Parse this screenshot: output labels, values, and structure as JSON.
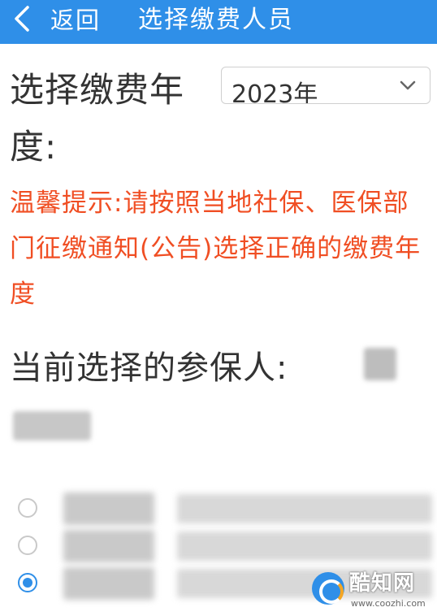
{
  "header": {
    "back_label": "返回",
    "title": "选择缴费人员",
    "background_color": "#2f8fe8"
  },
  "year": {
    "label": "选择缴费年度:",
    "selected_value": "2023年"
  },
  "tip": {
    "text": "温馨提示:请按照当地社保、医保部门征缴通知(公告)选择正确的缴费年度",
    "color": "#f04e23"
  },
  "insured": {
    "label": "当前选择的参保人:"
  },
  "people": [
    {
      "checked": false
    },
    {
      "checked": false
    },
    {
      "checked": true
    }
  ],
  "watermark": {
    "name": "酷知网",
    "url": "www.coozhi.com"
  }
}
